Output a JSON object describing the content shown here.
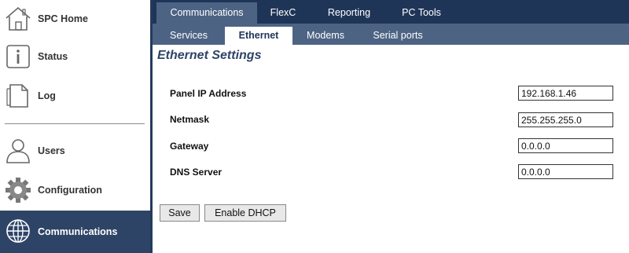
{
  "sidebar": {
    "items": [
      {
        "label": "SPC Home",
        "icon": "house-icon"
      },
      {
        "label": "Status",
        "icon": "info-icon"
      },
      {
        "label": "Log",
        "icon": "document-icon"
      },
      {
        "label": "Users",
        "icon": "user-icon"
      },
      {
        "label": "Configuration",
        "icon": "gear-icon"
      },
      {
        "label": "Communications",
        "icon": "globe-icon",
        "active": true
      }
    ]
  },
  "top_tabs": [
    {
      "label": "Communications",
      "active": true
    },
    {
      "label": "FlexC"
    },
    {
      "label": "Reporting"
    },
    {
      "label": "PC Tools"
    }
  ],
  "sub_tabs": [
    {
      "label": "Services"
    },
    {
      "label": "Ethernet",
      "active": true
    },
    {
      "label": "Modems"
    },
    {
      "label": "Serial ports"
    }
  ],
  "page": {
    "title": "Ethernet Settings",
    "fields": [
      {
        "label": "Panel IP Address",
        "value": "192.168.1.46"
      },
      {
        "label": "Netmask",
        "value": "255.255.255.0"
      },
      {
        "label": "Gateway",
        "value": "0.0.0.0"
      },
      {
        "label": "DNS Server",
        "value": "0.0.0.0"
      }
    ],
    "buttons": {
      "save": "Save",
      "dhcp": "Enable DHCP"
    }
  },
  "colors": {
    "nav_dark": "#1f3558",
    "nav_mid": "#4d6384",
    "active_sidebar": "#2e4467",
    "title": "#2e4467"
  }
}
